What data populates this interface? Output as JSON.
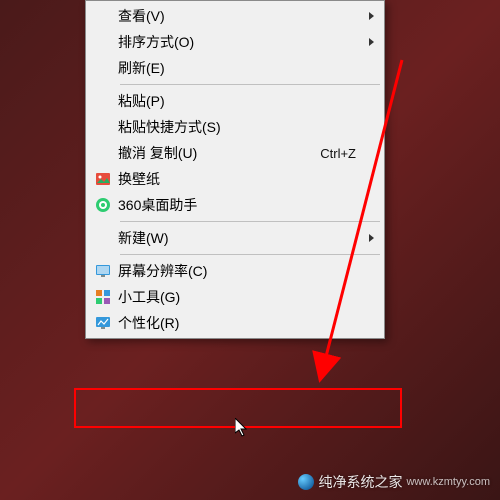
{
  "menu": {
    "items": [
      {
        "label": "查看(V)",
        "submenu": true
      },
      {
        "label": "排序方式(O)",
        "submenu": true
      },
      {
        "label": "刷新(E)"
      },
      {
        "sep": true
      },
      {
        "label": "粘贴(P)"
      },
      {
        "label": "粘贴快捷方式(S)"
      },
      {
        "label": "撤消 复制(U)",
        "shortcut": "Ctrl+Z"
      },
      {
        "label": "换壁纸",
        "icon": "wallpaper-icon"
      },
      {
        "label": "360桌面助手",
        "icon": "assistant-icon"
      },
      {
        "sep": true
      },
      {
        "label": "新建(W)",
        "submenu": true
      },
      {
        "sep": true
      },
      {
        "label": "屏幕分辨率(C)",
        "icon": "resolution-icon"
      },
      {
        "label": "小工具(G)",
        "icon": "gadgets-icon"
      },
      {
        "label": "个性化(R)",
        "icon": "personalize-icon",
        "highlight": true
      }
    ]
  },
  "watermark": {
    "text": "纯净系统之家",
    "url": "www.kzmtyy.com"
  }
}
